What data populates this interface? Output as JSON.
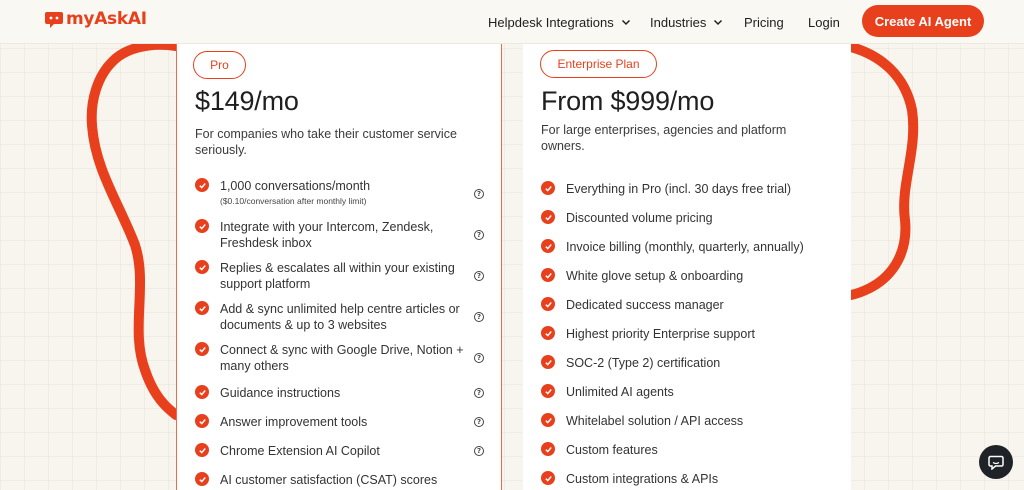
{
  "brand": {
    "name": "myAskAI",
    "color": "#e8401c"
  },
  "nav": {
    "items": [
      {
        "label": "Helpdesk Integrations",
        "has_dropdown": true
      },
      {
        "label": "Industries",
        "has_dropdown": true
      },
      {
        "label": "Pricing",
        "has_dropdown": false
      },
      {
        "label": "Login",
        "has_dropdown": false
      }
    ],
    "cta_label": "Create AI Agent"
  },
  "plans": {
    "pro": {
      "badge": "Pro",
      "price": "$149/mo",
      "description": "For companies who take their customer service seriously.",
      "features": [
        {
          "text": "1,000 conversations/month",
          "note": "($0.10/conversation after monthly limit)"
        },
        {
          "text": "Integrate with your Intercom, Zendesk, Freshdesk inbox"
        },
        {
          "text": "Replies & escalates all within your existing support platform"
        },
        {
          "text": "Add & sync unlimited help centre articles or documents & up to 3 websites"
        },
        {
          "text": "Connect & sync with Google Drive, Notion + many others"
        },
        {
          "text": "Guidance instructions"
        },
        {
          "text": "Answer improvement tools"
        },
        {
          "text": "Chrome Extension AI Copilot"
        },
        {
          "text": "AI customer satisfaction (CSAT) scores"
        }
      ],
      "help_icon": "question-circle-icon"
    },
    "enterprise": {
      "badge": "Enterprise Plan",
      "price": "From $999/mo",
      "description": "For large enterprises, agencies and platform owners.",
      "features": [
        {
          "text": "Everything in Pro (incl. 30 days free trial)"
        },
        {
          "text": "Discounted volume pricing"
        },
        {
          "text": "Invoice billing (monthly, quarterly, annually)"
        },
        {
          "text": "White glove setup & onboarding"
        },
        {
          "text": "Dedicated success manager"
        },
        {
          "text": "Highest priority Enterprise support"
        },
        {
          "text": "SOC-2 (Type 2) certification"
        },
        {
          "text": "Unlimited AI agents"
        },
        {
          "text": "Whitelabel solution / API access"
        },
        {
          "text": "Custom features"
        },
        {
          "text": "Custom integrations & APIs"
        }
      ]
    }
  },
  "chat_widget": {
    "icon": "chat-bubble-icon"
  },
  "colors": {
    "accent": "#e8401c",
    "background": "#f8f5ee",
    "chat_button": "#1f2226"
  }
}
